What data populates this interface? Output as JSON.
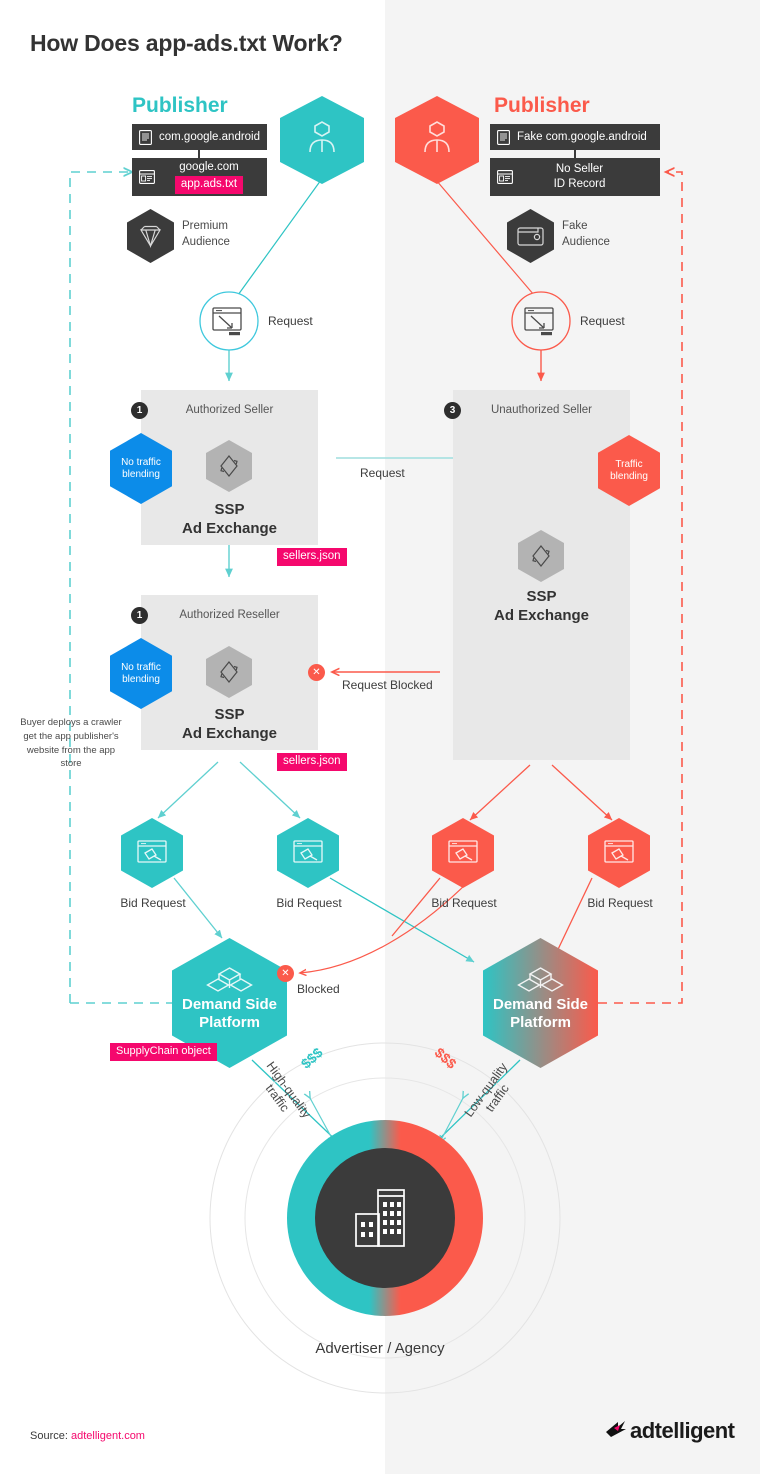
{
  "page": {
    "title": "How Does app-ads.txt Work?",
    "background": "#ffffff",
    "right_panel_bg": "#f4f4f4"
  },
  "colors": {
    "teal": "#2ec4c4",
    "red": "#fb5a4b",
    "pink": "#f5086d",
    "blue": "#0c8ce9",
    "dark": "#3b3b3b",
    "gray_panel": "#e8e8e8",
    "gray_hex": "#b3b3b3"
  },
  "left_branch": {
    "publisher_label": "Publisher",
    "app_bar": {
      "text": "com.google.android",
      "icon": "mobile-app-icon"
    },
    "site_bar": {
      "text": "google.com",
      "tag": "app.ads.txt",
      "icon": "website-icon"
    },
    "audience": {
      "label_line1": "Premium",
      "label_line2": "Audience",
      "icon": "diamond-icon"
    },
    "request": {
      "label": "Request",
      "icon": "request-window-icon"
    },
    "seller_panel": {
      "step": "1",
      "title": "Authorized Seller",
      "badge_line1": "No traffic",
      "badge_line2": "blending",
      "ssp_line1": "SSP",
      "ssp_line2": "Ad Exchange",
      "tag": "sellers.json",
      "icon": "exchange-arrows-icon"
    },
    "reseller_panel": {
      "step": "1",
      "title": "Authorized Reseller",
      "badge_line1": "No traffic",
      "badge_line2": "blending",
      "ssp_line1": "SSP",
      "ssp_line2": "Ad Exchange",
      "tag": "sellers.json",
      "icon": "exchange-arrows-icon"
    },
    "bid_requests": [
      {
        "label": "Bid Request",
        "icon": "bid-window-icon"
      },
      {
        "label": "Bid Request",
        "icon": "bid-window-icon"
      }
    ],
    "dsp": {
      "line1": "Demand Side",
      "line2": "Platform",
      "tag": "SupplyChain object",
      "icon": "cubes-icon"
    },
    "crawler_note": "Buyer deploys a crawler get the app publisher's website from the app store",
    "traffic": {
      "money": "$$$",
      "label_line1": "High-quality",
      "label_line2": "traffic"
    }
  },
  "right_branch": {
    "publisher_label": "Publisher",
    "app_bar": {
      "text": "Fake com.google.android",
      "icon": "mobile-app-icon"
    },
    "site_bar": {
      "line1": "No Seller",
      "line2": "ID Record",
      "icon": "website-icon"
    },
    "audience": {
      "label_line1": "Fake",
      "label_line2": "Audience",
      "icon": "wallet-icon"
    },
    "request": {
      "label": "Request",
      "icon": "request-window-icon"
    },
    "seller_panel": {
      "step": "3",
      "title": "Unauthorized Seller",
      "badge_line1": "Traffic",
      "badge_line2": "blending",
      "ssp_line1": "SSP",
      "ssp_line2": "Ad Exchange",
      "icon": "exchange-arrows-icon"
    },
    "bid_requests": [
      {
        "label": "Bid Request",
        "icon": "bid-window-icon"
      },
      {
        "label": "Bid Request",
        "icon": "bid-window-icon"
      }
    ],
    "dsp": {
      "line1": "Demand Side",
      "line2": "Platform",
      "icon": "cubes-icon"
    },
    "traffic": {
      "money": "$$$",
      "label_line1": "Low-quality",
      "label_line2": "traffic"
    }
  },
  "flows": {
    "request_between_sellers": "Request",
    "request_blocked": "Request Blocked",
    "blocked": "Blocked"
  },
  "advertiser": {
    "label": "Advertiser / Agency",
    "icon": "buildings-icon"
  },
  "footer": {
    "source_prefix": "Source:",
    "source_link": "adtelligent.com",
    "brand": "adtelligent",
    "brand_icon": "adtelligent-logo-icon"
  }
}
